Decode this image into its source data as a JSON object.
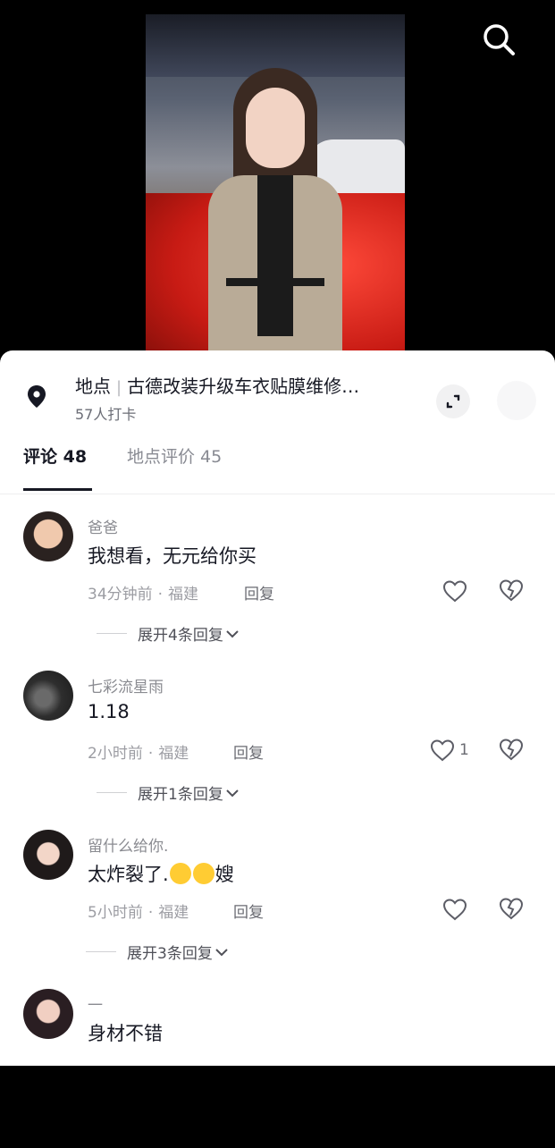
{
  "location": {
    "prefix": "地点",
    "name": "古德改装升级车衣贴膜维修…",
    "checkins": "57人打卡"
  },
  "tabs": [
    {
      "label": "评论 48"
    },
    {
      "label": "地点评价 45"
    }
  ],
  "comments": [
    {
      "name": "爸爸",
      "text": "我想看，无元给你买",
      "time": "34分钟前",
      "region": "福建",
      "reply": "回复",
      "likes": "",
      "expand": "展开4条回复"
    },
    {
      "name": "七彩流星雨",
      "text": "1.18",
      "time": "2小时前",
      "region": "福建",
      "reply": "回复",
      "likes": "1",
      "expand": "展开1条回复"
    },
    {
      "name": "留什么给你.",
      "text_before": "太炸裂了.",
      "text_after": "嫂",
      "time": "5小时前",
      "region": "福建",
      "reply": "回复",
      "likes": "",
      "expand": "展开3条回复"
    },
    {
      "name": "一",
      "text": "身材不错"
    }
  ],
  "meta_separator": "·",
  "icons": {
    "search": "search-icon",
    "location": "location-pin-icon",
    "expand": "expand-icon",
    "like": "heart-icon",
    "dislike": "broken-heart-icon",
    "chevron": "chevron-down-icon",
    "emoji": "laughing-tears-emoji"
  }
}
